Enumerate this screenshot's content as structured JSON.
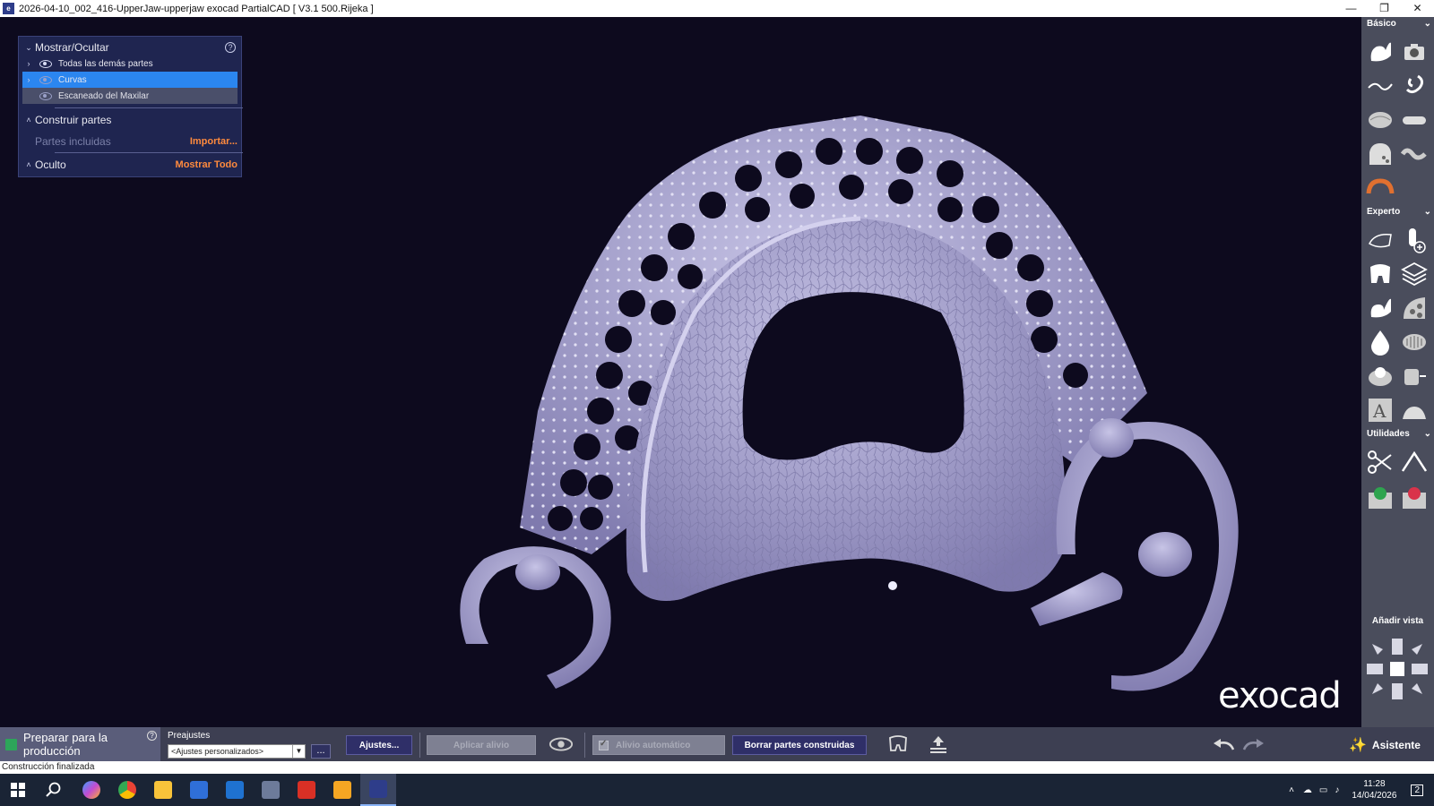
{
  "window": {
    "title": "2026-04-10_002_416-UpperJaw-upperjaw exocad PartialCAD [ V3.1 500.Rijeka ]",
    "app_icon": "exocad",
    "controls": [
      "—",
      "❐",
      "✕"
    ]
  },
  "panel": {
    "header": "Mostrar/Ocultar",
    "items": [
      {
        "label": "Todas las demás partes",
        "icon": "eye-icon",
        "state": "normal"
      },
      {
        "label": "Curvas",
        "icon": "eye-off-icon",
        "state": "selected"
      },
      {
        "label": "Escaneado del Maxilar",
        "icon": "eye-off-icon",
        "state": "grey"
      }
    ],
    "build_parts": "Construir partes",
    "included_parts": "Partes incluidas",
    "import": "Importar...",
    "hidden": "Oculto",
    "show_all": "Mostrar Todo",
    "help": "?"
  },
  "sidebar": {
    "basic": "Básico",
    "expert": "Experto",
    "utilities": "Utilidades",
    "add_view": "Añadir vista"
  },
  "logo": "exocad",
  "bottom": {
    "prepare": "Preparar para la producción",
    "help": "?",
    "presets_label": "Preajustes",
    "presets_value": "<Ajustes personalizados>",
    "dots": "...",
    "settings": "Ajustes...",
    "apply_relief": "Aplicar alivio",
    "auto_relief": "Alivio automático",
    "delete_parts": "Borrar partes construidas",
    "assistant": "Asistente"
  },
  "status": "Construcción finalizada",
  "clock": {
    "time": "11:28",
    "date": "14/04/2026"
  },
  "tray": {
    "notifications": "2"
  },
  "colors": {
    "accent": "#2b86f0",
    "orange": "#ff8a3d",
    "model": "#a6a2cf",
    "bg": "#0d0a1e"
  }
}
